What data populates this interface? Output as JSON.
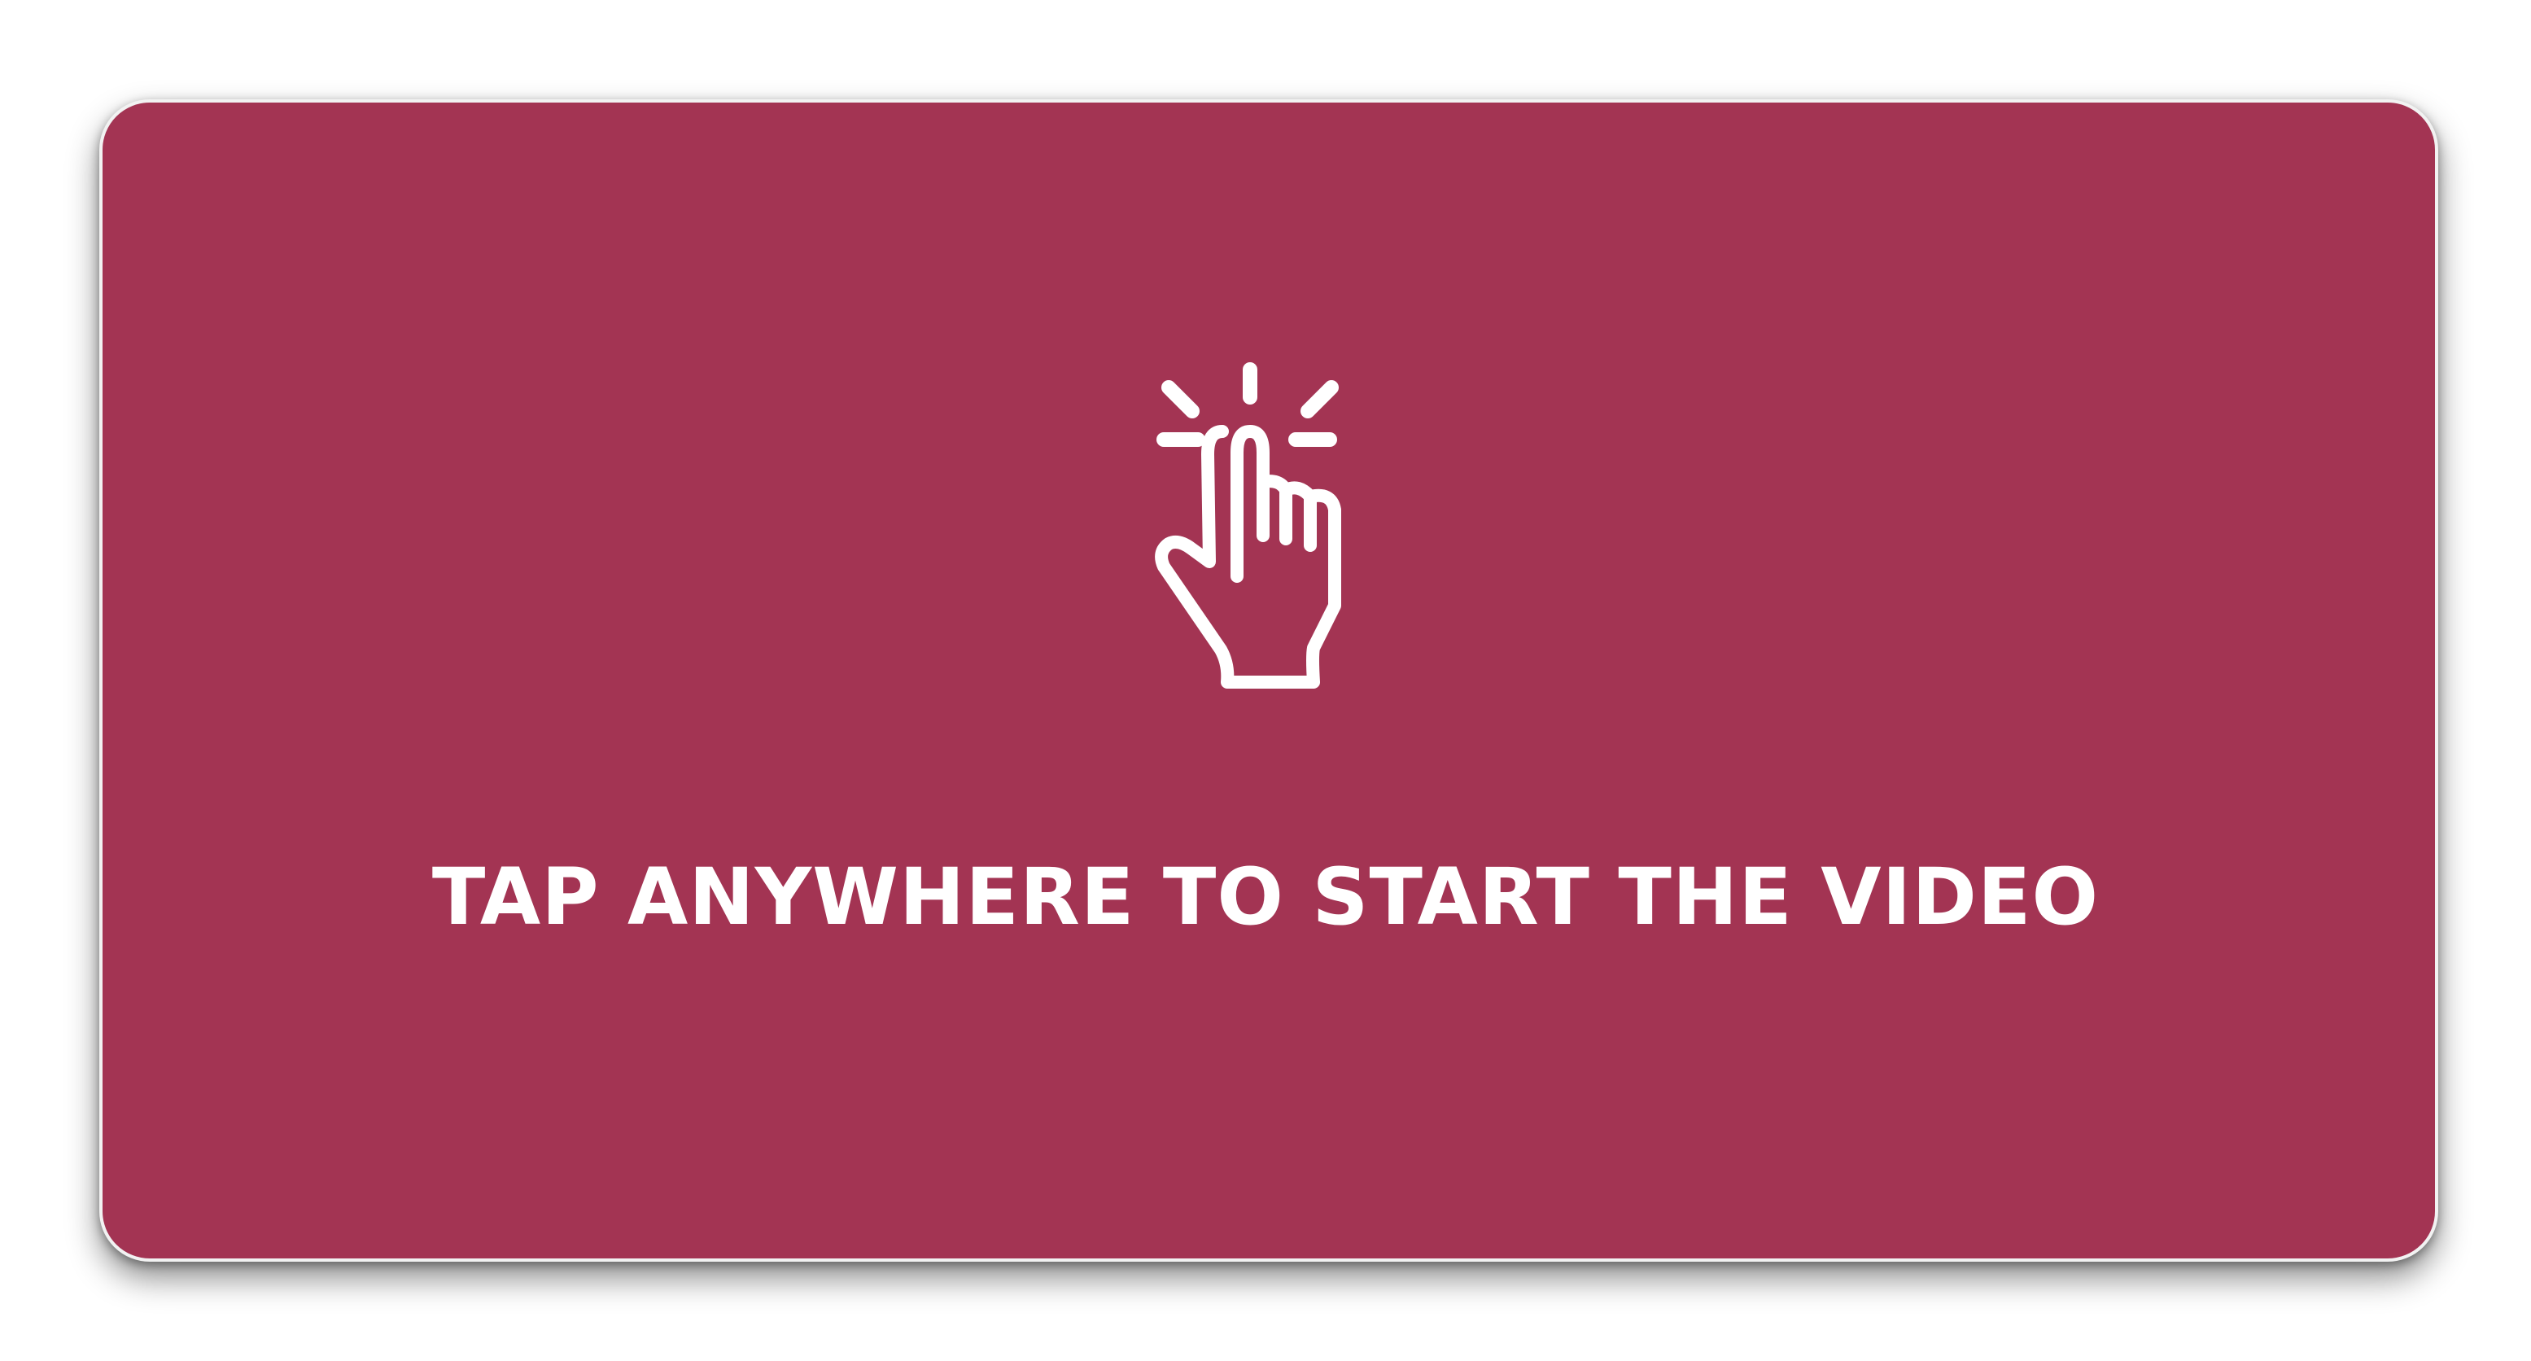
{
  "overlay": {
    "prompt_text": "TAP ANYWHERE TO START THE VIDEO",
    "icon": "tap-hand-icon",
    "background_color": "#a33453",
    "text_color": "#ffffff"
  }
}
